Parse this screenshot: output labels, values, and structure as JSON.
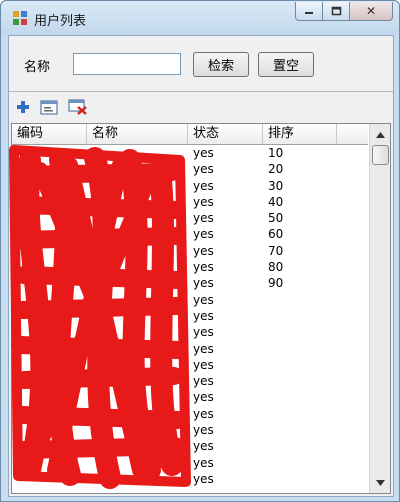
{
  "window": {
    "title": "用户列表",
    "close_glyph": "✕"
  },
  "search": {
    "name_label": "名称",
    "name_value": "",
    "search_button": "检索",
    "reset_button": "置空"
  },
  "toolbar": {
    "icons": [
      "add-icon",
      "edit-icon",
      "delete-icon"
    ]
  },
  "grid": {
    "columns": [
      "编码",
      "名称",
      "状态",
      "排序"
    ],
    "rows": [
      {
        "status": "yes",
        "order": "10"
      },
      {
        "status": "yes",
        "order": "20"
      },
      {
        "status": "yes",
        "order": "30"
      },
      {
        "status": "yes",
        "order": "40"
      },
      {
        "status": "yes",
        "order": "50"
      },
      {
        "status": "yes",
        "order": "60"
      },
      {
        "status": "yes",
        "order": "70"
      },
      {
        "status": "yes",
        "order": "80"
      },
      {
        "status": "yes",
        "order": "90"
      },
      {
        "status": "yes",
        "order": ""
      },
      {
        "status": "yes",
        "order": ""
      },
      {
        "status": "yes",
        "order": ""
      },
      {
        "status": "yes",
        "order": ""
      },
      {
        "status": "yes",
        "order": ""
      },
      {
        "status": "yes",
        "order": ""
      },
      {
        "status": "yes",
        "order": ""
      },
      {
        "status": "yes",
        "order": ""
      },
      {
        "status": "yes",
        "order": ""
      },
      {
        "status": "yes",
        "order": ""
      },
      {
        "status": "yes",
        "order": ""
      },
      {
        "status": "yes",
        "order": ""
      }
    ]
  },
  "colors": {
    "redaction": "#e81919"
  }
}
